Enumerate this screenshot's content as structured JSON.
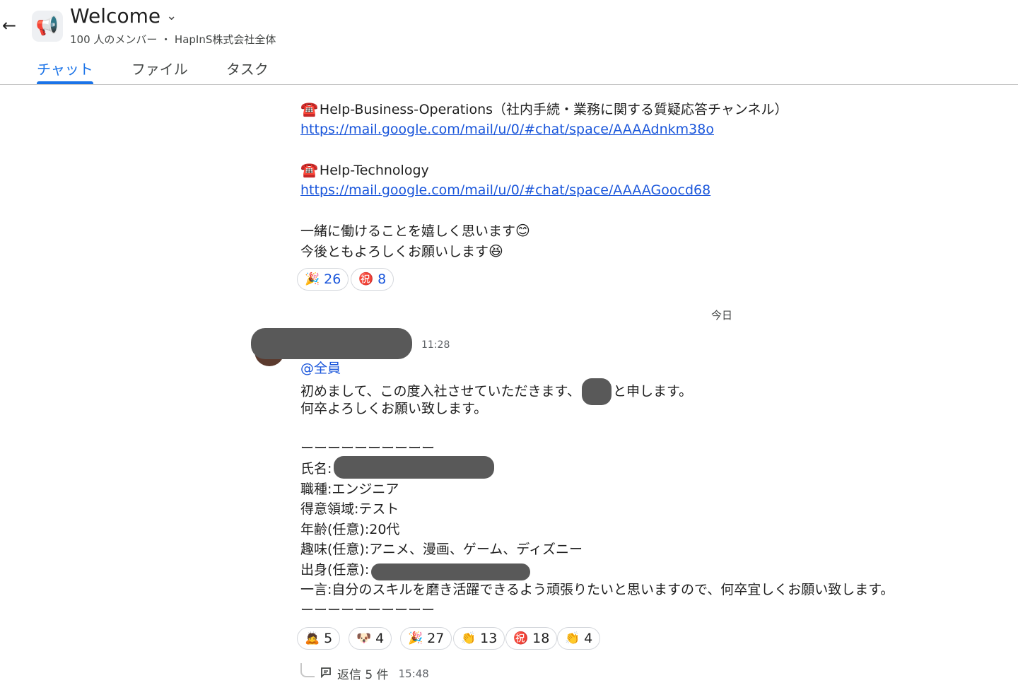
{
  "header": {
    "title": "Welcome",
    "subtitle": "100 人のメンバー ・ HapInS株式会社全体",
    "space_icon": "📢",
    "back_icon": "←",
    "dropdown_icon": "⌄"
  },
  "tabs": [
    {
      "label": "チャット",
      "active": true
    },
    {
      "label": "ファイル",
      "active": false
    },
    {
      "label": "タスク",
      "active": false
    }
  ],
  "message1": {
    "channel1_name": "Help-Business-Operations（社内手続・業務に関する質疑応答チャンネル）",
    "channel1_link": "https://mail.google.com/mail/u/0/#chat/space/AAAAdnkm38o",
    "channel2_name": "Help-Technology",
    "channel2_link": "https://mail.google.com/mail/u/0/#chat/space/AAAAGoocd68",
    "closing1": "一緒に働けることを嬉しく思います",
    "closing1_emoji": "😊",
    "closing2": "今後ともよろしくお願いします",
    "closing2_emoji": "😆",
    "phone_emoji": "☎️",
    "reactions": [
      {
        "emoji": "🎉",
        "count": "26"
      },
      {
        "emoji": "㊗️",
        "count": "8"
      }
    ]
  },
  "date_divider": "今日",
  "message2": {
    "time": "11:28",
    "mention": "@全員",
    "intro_a": "初めまして、この度入社させていただきます、",
    "intro_b": "と申します。",
    "intro2": "何卒よろしくお願い致します。",
    "separator": "ーーーーーーーーーー",
    "name_label": "氏名:",
    "job": "職種:エンジニア",
    "specialty": "得意領域:テスト",
    "age": "年齢(任意):20代",
    "hobby": "趣味(任意):アニメ、漫画、ゲーム、ディズニー",
    "origin_label": "出身(任意):",
    "comment": "一言:自分のスキルを磨き活躍できるよう頑張りたいと思いますので、何卒宜しくお願い致します。",
    "reactions": [
      {
        "emoji": "🙇",
        "count": "5"
      },
      {
        "emoji": "🐶",
        "count": "4"
      },
      {
        "emoji": "🎉",
        "count": "27"
      },
      {
        "emoji": "👏",
        "count": "13"
      },
      {
        "emoji": "㊗️",
        "count": "18"
      },
      {
        "emoji": "👏",
        "count": "4"
      }
    ],
    "reply_label": "返信 5 件",
    "reply_time": "15:48"
  }
}
